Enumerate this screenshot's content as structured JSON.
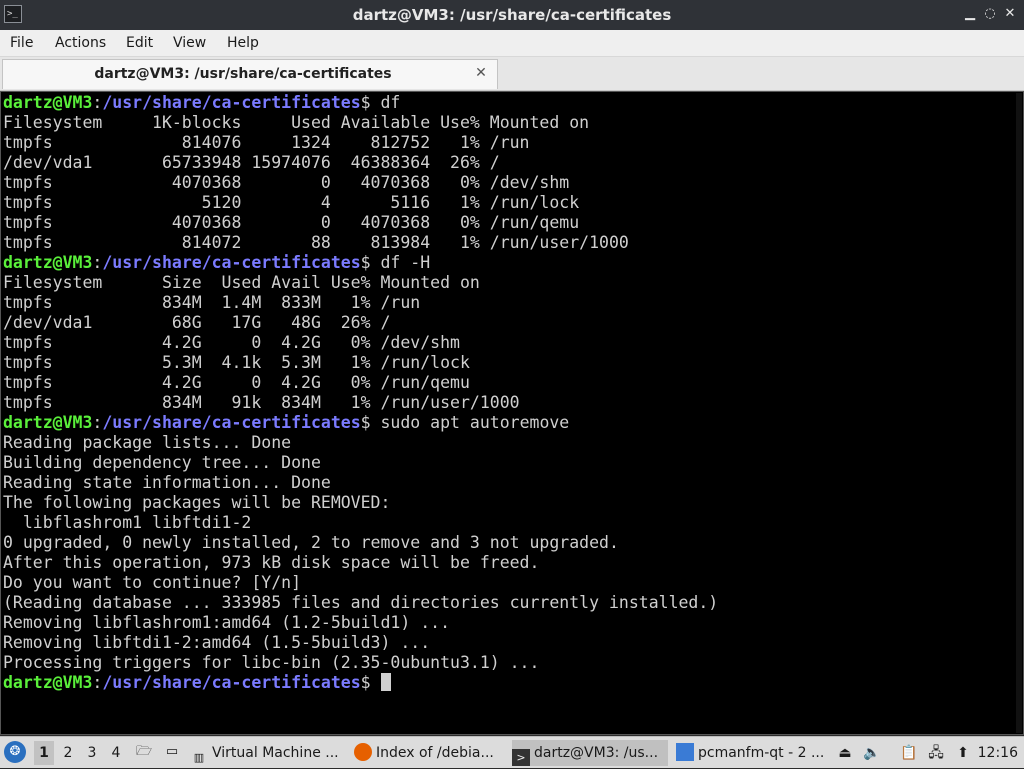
{
  "window": {
    "title": "dartz@VM3: /usr/share/ca-certificates",
    "app_icon": "terminal-icon",
    "minimize_glyph": "▁",
    "maximize_glyph": "◌",
    "close_glyph": "✕"
  },
  "menu": [
    "File",
    "Actions",
    "Edit",
    "View",
    "Help"
  ],
  "tab": {
    "label": "dartz@VM3: /usr/share/ca-certificates",
    "close_glyph": "✕"
  },
  "prompt": {
    "user": "dartz@VM3",
    "sep": ":",
    "path": "/usr/share/ca-certificates",
    "end": "$ "
  },
  "terminal": {
    "lines": [
      {
        "type": "prompt",
        "cmd": "df"
      },
      {
        "type": "out",
        "text": "Filesystem     1K-blocks     Used Available Use% Mounted on"
      },
      {
        "type": "out",
        "text": "tmpfs             814076     1324    812752   1% /run"
      },
      {
        "type": "out",
        "text": "/dev/vda1       65733948 15974076  46388364  26% /"
      },
      {
        "type": "out",
        "text": "tmpfs            4070368        0   4070368   0% /dev/shm"
      },
      {
        "type": "out",
        "text": "tmpfs               5120        4      5116   1% /run/lock"
      },
      {
        "type": "out",
        "text": "tmpfs            4070368        0   4070368   0% /run/qemu"
      },
      {
        "type": "out",
        "text": "tmpfs             814072       88    813984   1% /run/user/1000"
      },
      {
        "type": "prompt",
        "cmd": "df -H"
      },
      {
        "type": "out",
        "text": "Filesystem      Size  Used Avail Use% Mounted on"
      },
      {
        "type": "out",
        "text": "tmpfs           834M  1.4M  833M   1% /run"
      },
      {
        "type": "out",
        "text": "/dev/vda1        68G   17G   48G  26% /"
      },
      {
        "type": "out",
        "text": "tmpfs           4.2G     0  4.2G   0% /dev/shm"
      },
      {
        "type": "out",
        "text": "tmpfs           5.3M  4.1k  5.3M   1% /run/lock"
      },
      {
        "type": "out",
        "text": "tmpfs           4.2G     0  4.2G   0% /run/qemu"
      },
      {
        "type": "out",
        "text": "tmpfs           834M   91k  834M   1% /run/user/1000"
      },
      {
        "type": "prompt",
        "cmd": "sudo apt autoremove"
      },
      {
        "type": "out",
        "text": "Reading package lists... Done"
      },
      {
        "type": "out",
        "text": "Building dependency tree... Done"
      },
      {
        "type": "out",
        "text": "Reading state information... Done"
      },
      {
        "type": "out",
        "text": "The following packages will be REMOVED:"
      },
      {
        "type": "out",
        "text": "  libflashrom1 libftdi1-2"
      },
      {
        "type": "out",
        "text": "0 upgraded, 0 newly installed, 2 to remove and 3 not upgraded."
      },
      {
        "type": "out",
        "text": "After this operation, 973 kB disk space will be freed."
      },
      {
        "type": "out",
        "text": "Do you want to continue? [Y/n]"
      },
      {
        "type": "out",
        "text": "(Reading database ... 333985 files and directories currently installed.)"
      },
      {
        "type": "out",
        "text": "Removing libflashrom1:amd64 (1.2-5build1) ..."
      },
      {
        "type": "out",
        "text": "Removing libftdi1-2:amd64 (1.5-5build3) ..."
      },
      {
        "type": "out",
        "text": "Processing triggers for libc-bin (2.35-0ubuntu3.1) ..."
      },
      {
        "type": "prompt",
        "cmd": "",
        "cursor": true
      }
    ]
  },
  "taskbar": {
    "start_icon": "menu-icon",
    "workspaces": [
      "1",
      "2",
      "3",
      "4"
    ],
    "active_workspace": "1",
    "launchers": [
      "file-manager-icon",
      "desktop-icon"
    ],
    "tasks": [
      {
        "label": "Virtual Machine ...",
        "icon": "vm-icon",
        "active": false
      },
      {
        "label": "Index of /debia...",
        "icon": "firefox-icon",
        "active": false
      },
      {
        "label": "dartz@VM3: /us...",
        "icon": "terminal-icon",
        "active": true
      },
      {
        "label": "pcmanfm-qt - 2 ...",
        "icon": "folder-icon",
        "active": false
      }
    ],
    "tray": [
      "eject-icon",
      "volume-icon",
      "clipboard-icon",
      "network-icon",
      "update-icon"
    ],
    "clock": "12:16"
  },
  "colors": {
    "prompt_user": "#5af03a",
    "prompt_path": "#7b7bff",
    "terminal_bg": "#000000",
    "terminal_fg": "#d0d0d0"
  }
}
